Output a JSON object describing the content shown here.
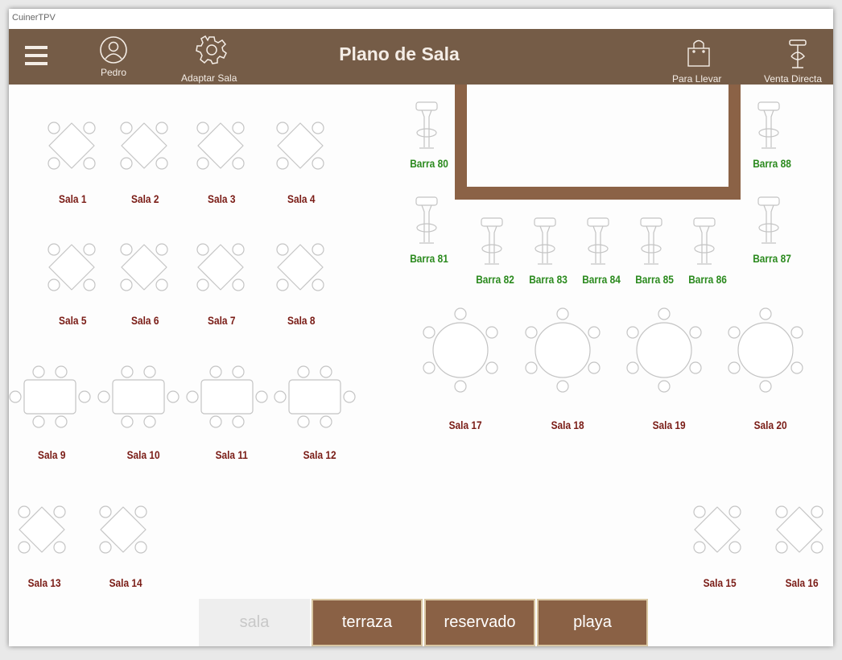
{
  "window": {
    "title": "CuinerTPV"
  },
  "header": {
    "title": "Plano de Sala",
    "user_label": "Pedro",
    "adapt_label": "Adaptar Sala",
    "takeaway_label": "Para Llevar",
    "direct_sale_label": "Venta Directa"
  },
  "floor": {
    "tables": [
      {
        "id": "t1",
        "label": "Sala 1",
        "shape": "diamond"
      },
      {
        "id": "t2",
        "label": "Sala 2",
        "shape": "diamond"
      },
      {
        "id": "t3",
        "label": "Sala 3",
        "shape": "diamond"
      },
      {
        "id": "t4",
        "label": "Sala 4",
        "shape": "diamond"
      },
      {
        "id": "t5",
        "label": "Sala 5",
        "shape": "diamond"
      },
      {
        "id": "t6",
        "label": "Sala 6",
        "shape": "diamond"
      },
      {
        "id": "t7",
        "label": "Sala 7",
        "shape": "diamond"
      },
      {
        "id": "t8",
        "label": "Sala 8",
        "shape": "diamond"
      },
      {
        "id": "t9",
        "label": "Sala 9",
        "shape": "rect"
      },
      {
        "id": "t10",
        "label": "Sala 10",
        "shape": "rect"
      },
      {
        "id": "t11",
        "label": "Sala 11",
        "shape": "rect"
      },
      {
        "id": "t12",
        "label": "Sala 12",
        "shape": "rect"
      },
      {
        "id": "t13",
        "label": "Sala 13",
        "shape": "diamond"
      },
      {
        "id": "t14",
        "label": "Sala 14",
        "shape": "diamond"
      },
      {
        "id": "t15",
        "label": "Sala 15",
        "shape": "diamond"
      },
      {
        "id": "t16",
        "label": "Sala 16",
        "shape": "diamond"
      },
      {
        "id": "t17",
        "label": "Sala 17",
        "shape": "round"
      },
      {
        "id": "t18",
        "label": "Sala 18",
        "shape": "round"
      },
      {
        "id": "t19",
        "label": "Sala 19",
        "shape": "round"
      },
      {
        "id": "t20",
        "label": "Sala 20",
        "shape": "round"
      }
    ],
    "stools": [
      {
        "id": "b80",
        "label": "Barra 80"
      },
      {
        "id": "b81",
        "label": "Barra 81"
      },
      {
        "id": "b82",
        "label": "Barra 82"
      },
      {
        "id": "b83",
        "label": "Barra 83"
      },
      {
        "id": "b84",
        "label": "Barra 84"
      },
      {
        "id": "b85",
        "label": "Barra 85"
      },
      {
        "id": "b86",
        "label": "Barra 86"
      },
      {
        "id": "b87",
        "label": "Barra 87"
      },
      {
        "id": "b88",
        "label": "Barra 88"
      }
    ]
  },
  "tabs": [
    {
      "label": "sala",
      "active": true
    },
    {
      "label": "terraza",
      "active": false
    },
    {
      "label": "reservado",
      "active": false
    },
    {
      "label": "playa",
      "active": false
    }
  ],
  "colors": {
    "header": "#755c47",
    "bar_counter": "#8b6246",
    "table_label": "#7a1c16",
    "stool_label": "#2b8a1e",
    "tab_inactive": "#8a6145"
  },
  "icons": {
    "menu": "hamburger-icon",
    "user": "user-icon",
    "settings": "gear-icon",
    "takeaway": "shopping-bag-icon",
    "direct_sale": "bar-stool-icon"
  }
}
